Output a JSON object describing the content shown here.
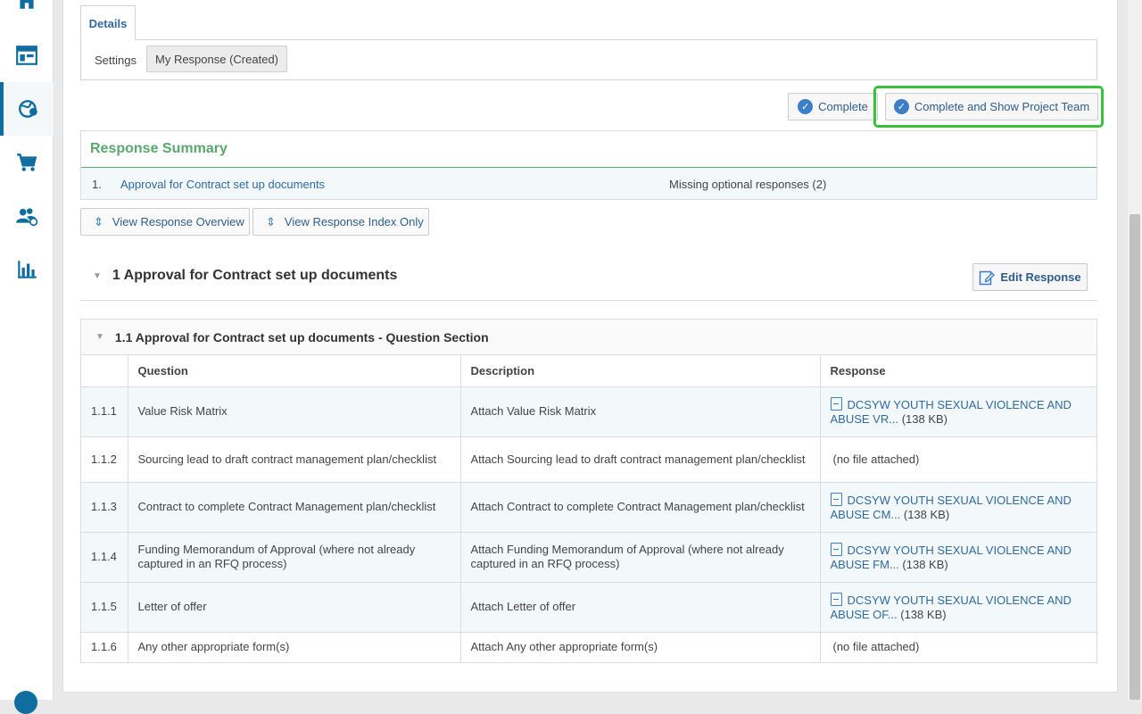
{
  "tabs": {
    "details": "Details"
  },
  "settings": {
    "label": "Settings",
    "response_button": "My Response (Created)"
  },
  "actions": {
    "complete": "Complete",
    "complete_show_team": "Complete and Show Project Team"
  },
  "summary": {
    "title": "Response Summary",
    "row": {
      "num": "1.",
      "link": "Approval for Contract set up documents",
      "status": "Missing optional responses (2)"
    }
  },
  "view_buttons": {
    "overview": "View Response Overview",
    "index_only": "View Response Index Only"
  },
  "section": {
    "title": "1 Approval for Contract set up documents",
    "edit": "Edit Response"
  },
  "question_section": {
    "title": "1.1 Approval for Contract set up documents - Question Section",
    "columns": {
      "num": "",
      "question": "Question",
      "description": "Description",
      "response": "Response"
    },
    "rows": [
      {
        "num": "1.1.1",
        "question": "Value Risk Matrix",
        "description": "Attach Value Risk Matrix",
        "file1": "DCSYW YOUTH SEXUAL VIOLENCE AND",
        "file2": "ABUSE VR...",
        "size": "(138 KB)",
        "no_file": ""
      },
      {
        "num": "1.1.2",
        "question": "Sourcing lead to draft contract management plan/checklist",
        "description": "Attach Sourcing lead to draft contract management plan/checklist",
        "file1": "",
        "file2": "",
        "size": "",
        "no_file": "(no file attached)"
      },
      {
        "num": "1.1.3",
        "question": "Contract to complete Contract Management plan/checklist",
        "description": "Attach Contract to complete Contract Management plan/checklist",
        "file1": "DCSYW YOUTH SEXUAL VIOLENCE AND",
        "file2": "ABUSE CM...",
        "size": "(138 KB)",
        "no_file": ""
      },
      {
        "num": "1.1.4",
        "question": "Funding Memorandum of Approval (where not already captured in an RFQ process)",
        "description": "Attach Funding Memorandum of Approval (where not already captured in an RFQ process)",
        "file1": "DCSYW YOUTH SEXUAL VIOLENCE AND",
        "file2": "ABUSE FM...",
        "size": "(138 KB)",
        "no_file": ""
      },
      {
        "num": "1.1.5",
        "question": "Letter of offer",
        "description": "Attach Letter of offer",
        "file1": "DCSYW YOUTH SEXUAL VIOLENCE AND",
        "file2": "ABUSE OF...",
        "size": "(138 KB)",
        "no_file": ""
      },
      {
        "num": "1.1.6",
        "question": "Any other appropriate form(s)",
        "description": "Attach Any other appropriate form(s)",
        "file1": "",
        "file2": "",
        "size": "",
        "no_file": "(no file attached)"
      }
    ]
  },
  "colors": {
    "accent": "#0f6e9f",
    "link": "#2f6aa0",
    "summary_green": "#5aa86d",
    "highlight": "#37c23a"
  },
  "sidebar_icons": [
    "home-icon",
    "dashboard-icon",
    "globe-icon",
    "cart-icon",
    "users-icon",
    "chart-icon"
  ]
}
